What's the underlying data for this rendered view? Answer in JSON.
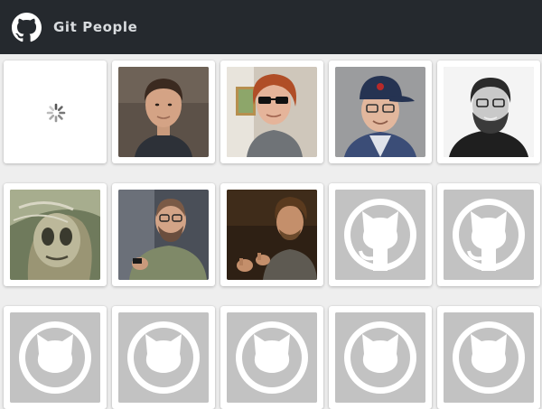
{
  "app": {
    "title": "Git People",
    "logo_icon": "github-octocat-icon"
  },
  "colors": {
    "appbar": "#25292e",
    "title_text": "#d9dcdf",
    "background": "#eeeeee",
    "card": "#ffffff",
    "placeholder_bg": "#c2c2c2"
  },
  "people": [
    {
      "state": "loading"
    },
    {
      "state": "photo",
      "avatar": "man-short-dark-hair-avatar"
    },
    {
      "state": "photo",
      "avatar": "man-sunglasses-red-hair-avatar"
    },
    {
      "state": "photo",
      "avatar": "man-glasses-blue-cap-avatar"
    },
    {
      "state": "photo",
      "avatar": "man-glasses-beard-bw-avatar"
    },
    {
      "state": "photo",
      "avatar": "alien-illustration-avatar"
    },
    {
      "state": "photo",
      "avatar": "man-glasses-phone-avatar"
    },
    {
      "state": "photo",
      "avatar": "man-gesturing-avatar"
    },
    {
      "state": "placeholder",
      "avatar": "octocat-placeholder-icon"
    },
    {
      "state": "placeholder",
      "avatar": "octocat-placeholder-icon"
    },
    {
      "state": "placeholder",
      "avatar": "octocat-placeholder-icon"
    },
    {
      "state": "placeholder",
      "avatar": "octocat-placeholder-icon"
    },
    {
      "state": "placeholder",
      "avatar": "octocat-placeholder-icon"
    },
    {
      "state": "placeholder",
      "avatar": "octocat-placeholder-icon"
    },
    {
      "state": "placeholder",
      "avatar": "octocat-placeholder-icon"
    }
  ]
}
